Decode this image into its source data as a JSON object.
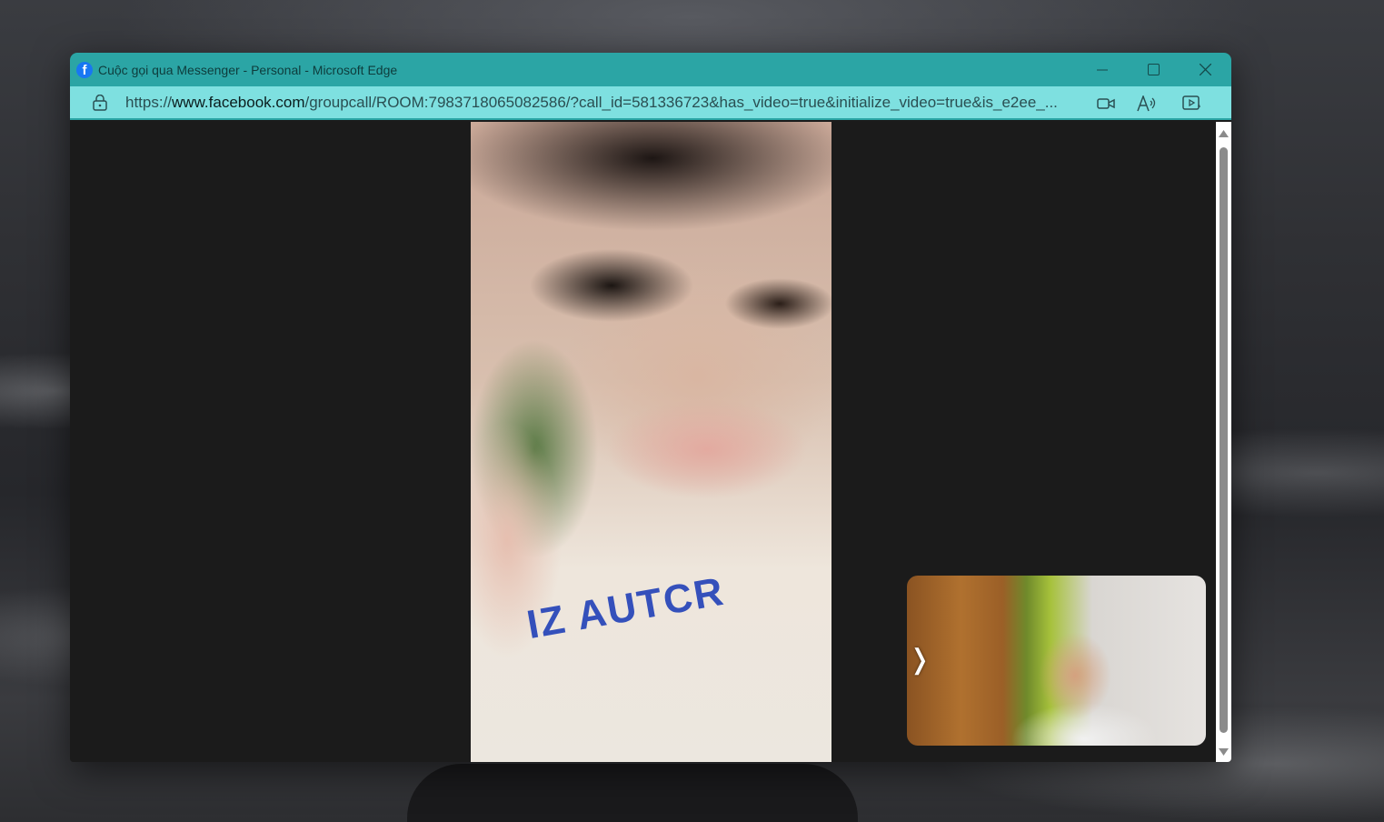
{
  "window": {
    "title": "Cuộc gọi qua Messenger - Personal - Microsoft Edge",
    "favicon": "facebook-icon",
    "favicon_letter": "f",
    "colors": {
      "titlebar": "#2ba5a5",
      "addressbar": "#7ee0e0"
    }
  },
  "controls": {
    "minimize": "minimize-icon",
    "maximize": "maximize-icon",
    "close": "close-icon"
  },
  "addressbar": {
    "url_prefix": "https://",
    "url_host": "www.facebook.com",
    "url_path": "/groupcall/ROOM:7983718065082586/?call_id=581336723&has_video=true&initialize_video=true&is_e2ee_...",
    "icons": [
      "lock-icon",
      "camera-icon",
      "read-aloud-icon",
      "picture-in-picture-icon"
    ]
  },
  "call": {
    "self_view_toggle": "❭"
  },
  "remote_video": {
    "shirt_text": "IZ AUTCR"
  },
  "scrollbar": {
    "up": "▲",
    "down": "▼"
  }
}
